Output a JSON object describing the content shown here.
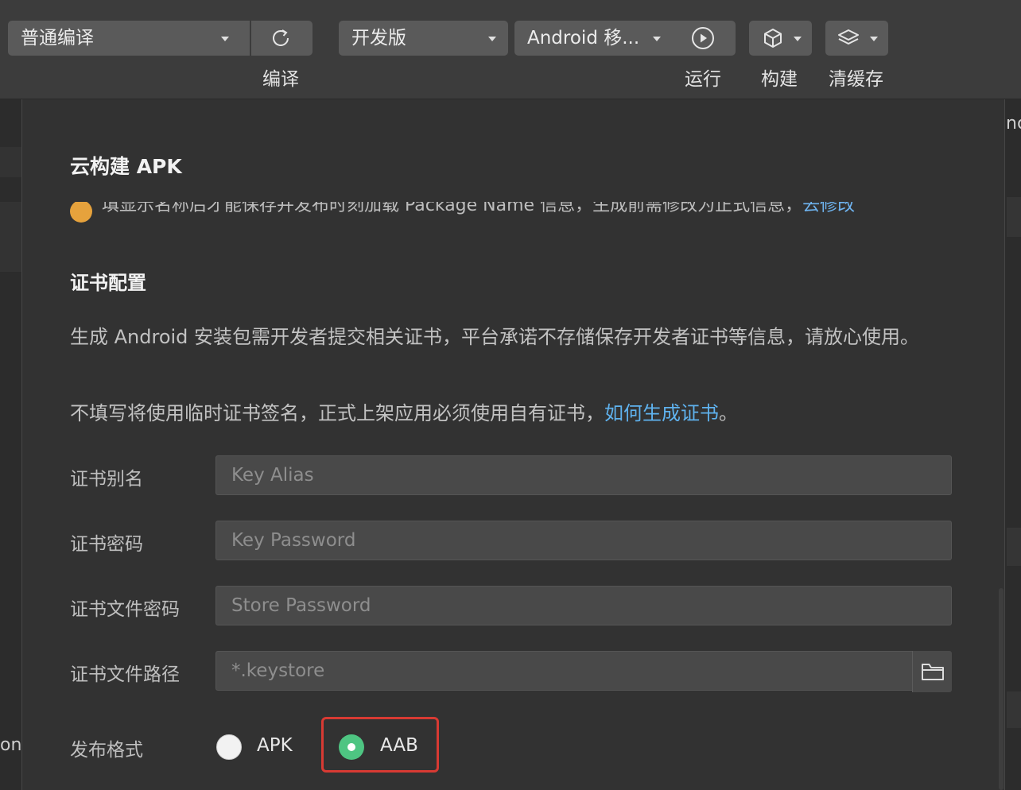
{
  "toolbar": {
    "compile_mode": "普通编译",
    "compile_label": "编译",
    "version": "开发版",
    "platform": "Android 移...",
    "run_label": "运行",
    "build_label": "构建",
    "clear_cache_label": "清缓存"
  },
  "background": {
    "right_peek": "nc",
    "left_peek": "on"
  },
  "dialog": {
    "title": "云构建 APK",
    "notice": {
      "text": "填显示名称后才能保存并发布时刻加载 Package Name 信息，生成前需修改为正式信息，",
      "link": "去修改"
    },
    "cert_section_title": "证书配置",
    "cert_desc": "生成 Android 安装包需开发者提交相关证书，平台承诺不存储保存开发者证书等信息，请放心使用。",
    "cert_hint": "不填写将使用临时证书签名，正式上架应用必须使用自有证书，",
    "cert_hint_link": "如何生成证书",
    "cert_hint_end": "。",
    "fields": {
      "alias_label": "证书别名",
      "alias_placeholder": "Key Alias",
      "password_label": "证书密码",
      "password_placeholder": "Key Password",
      "store_password_label": "证书文件密码",
      "store_password_placeholder": "Store Password",
      "path_label": "证书文件路径",
      "path_placeholder": "*.keystore"
    },
    "format": {
      "label": "发布格式",
      "options": [
        "APK",
        "AAB"
      ],
      "selected": "AAB"
    }
  },
  "colors": {
    "accent_link": "#5fb2ee",
    "radio_selected": "#4ec582",
    "highlight_border": "#d83a33",
    "warning": "#e6a23c"
  }
}
